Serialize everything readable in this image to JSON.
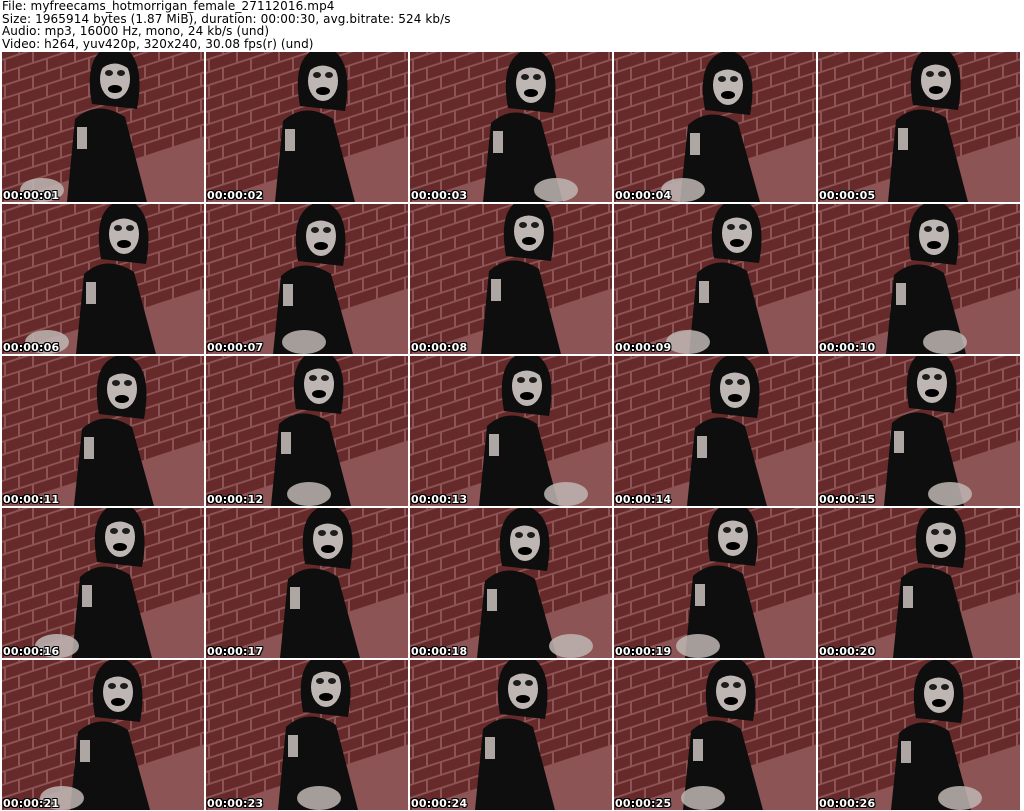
{
  "header": {
    "file_line": "File: myfreecams_hotmorrigan_female_27112016.mp4",
    "size_line": "Size: 1965914 bytes (1.87 MiB), duration: 00:00:30, avg.bitrate: 524 kb/s",
    "audio_line": "Audio: mp3, 16000 Hz, mono, 24 kb/s (und)",
    "video_line": "Video: h264, yuv420p, 320x240, 30.08 fps(r) (und)"
  },
  "thumbnails": [
    {
      "timestamp": "00:00:01"
    },
    {
      "timestamp": "00:00:02"
    },
    {
      "timestamp": "00:00:03"
    },
    {
      "timestamp": "00:00:04"
    },
    {
      "timestamp": "00:00:05"
    },
    {
      "timestamp": "00:00:06"
    },
    {
      "timestamp": "00:00:07"
    },
    {
      "timestamp": "00:00:08"
    },
    {
      "timestamp": "00:00:09"
    },
    {
      "timestamp": "00:00:10"
    },
    {
      "timestamp": "00:00:11"
    },
    {
      "timestamp": "00:00:12"
    },
    {
      "timestamp": "00:00:13"
    },
    {
      "timestamp": "00:00:14"
    },
    {
      "timestamp": "00:00:15"
    },
    {
      "timestamp": "00:00:16"
    },
    {
      "timestamp": "00:00:17"
    },
    {
      "timestamp": "00:00:18"
    },
    {
      "timestamp": "00:00:19"
    },
    {
      "timestamp": "00:00:20"
    },
    {
      "timestamp": "00:00:21"
    },
    {
      "timestamp": "00:00:23"
    },
    {
      "timestamp": "00:00:24"
    },
    {
      "timestamp": "00:00:25"
    },
    {
      "timestamp": "00:00:26"
    }
  ],
  "colors": {
    "brick": "#8a3a3a",
    "mortar": "#c27a7a",
    "figure": "#101010",
    "skin": "#d9d0cc"
  }
}
